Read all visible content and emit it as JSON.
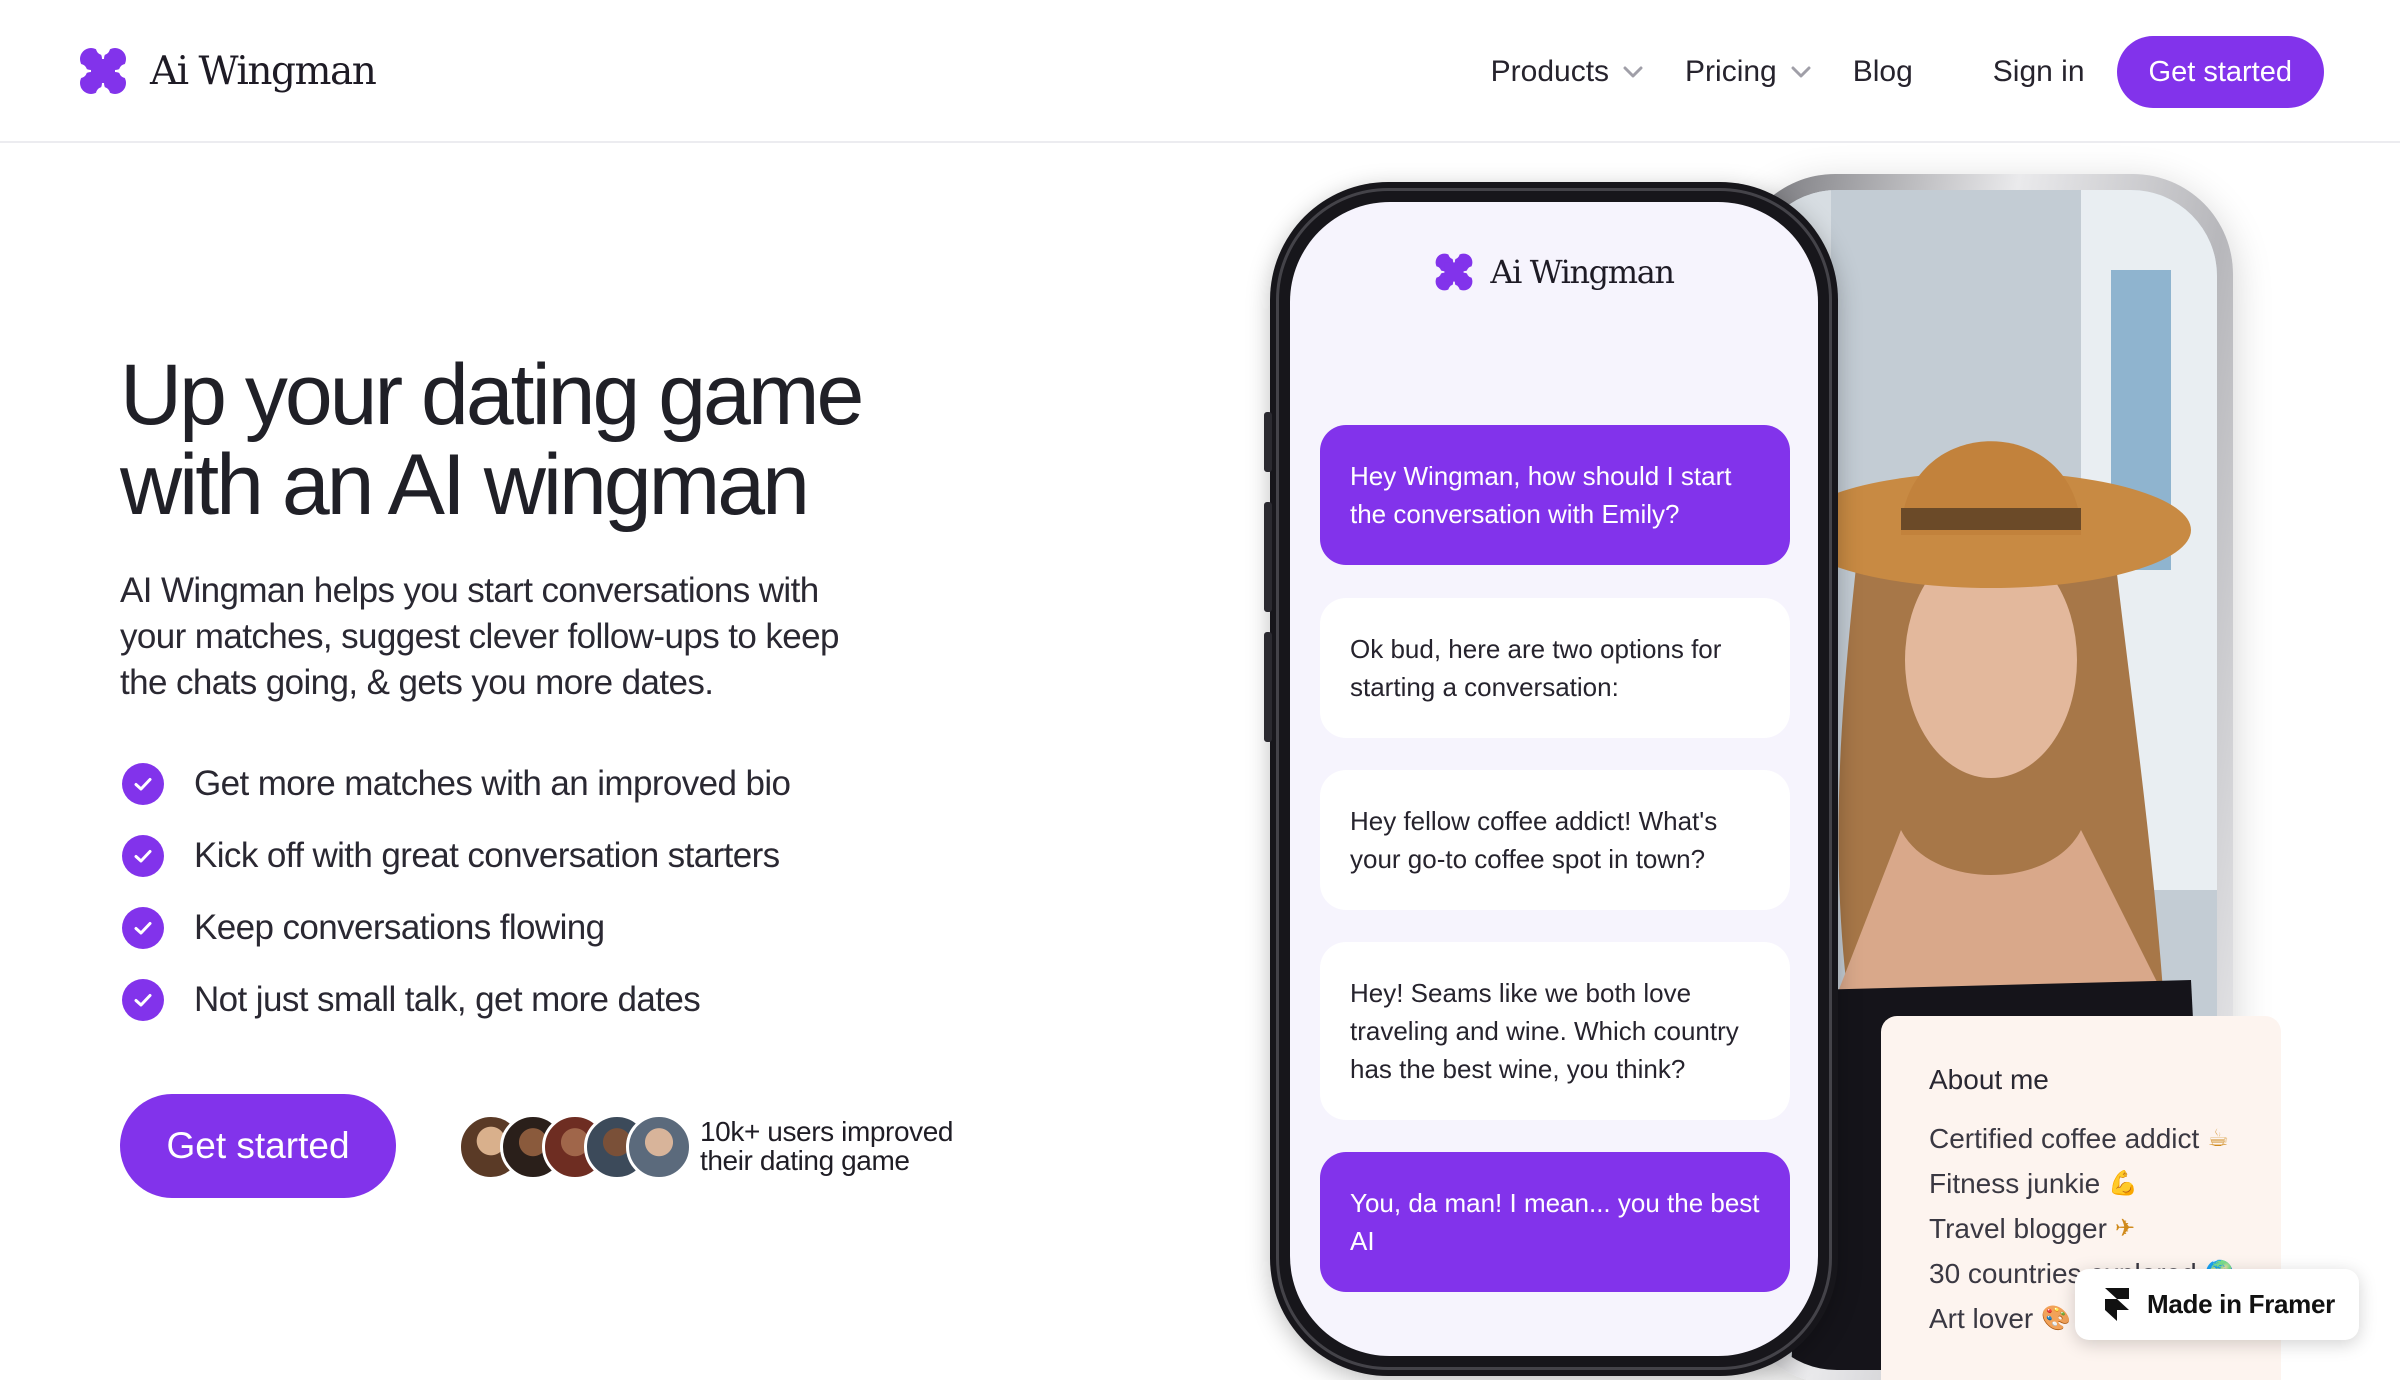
{
  "colors": {
    "accent": "#8233eb",
    "text": "#202027",
    "card_bg": "#fdf4ef",
    "screen_bg": "#f6f4fd"
  },
  "nav": {
    "brand": "Ai Wingman",
    "products": "Products",
    "pricing": "Pricing",
    "blog": "Blog",
    "sign_in": "Sign in",
    "cta": "Get started"
  },
  "hero": {
    "title_line1": "Up your dating game",
    "title_line2": "with an AI wingman",
    "subtitle": "AI Wingman helps you start conversations with your matches, suggest clever follow-ups to keep the chats going, & gets you more dates.",
    "features": [
      "Get more matches with an improved bio",
      "Kick off with great conversation starters",
      "Keep conversations flowing",
      "Not just small talk, get more dates"
    ],
    "cta": "Get started",
    "social_proof_line1": "10k+ users improved",
    "social_proof_line2": "their dating game"
  },
  "phone": {
    "brand": "Ai Wingman",
    "messages": [
      {
        "role": "user",
        "text": "Hey Wingman, how should I start the conversation with Emily?"
      },
      {
        "role": "bot",
        "text": "Ok bud, here are two options for starting a conversation:"
      },
      {
        "role": "bot",
        "text": "Hey fellow coffee addict! What's your go-to coffee spot in town?"
      },
      {
        "role": "bot",
        "text": "Hey! Seams like we both love traveling and wine. Which country has the best wine, you think?"
      },
      {
        "role": "user",
        "text": "You, da man! I mean... you the best AI"
      }
    ]
  },
  "about": {
    "title": "About me",
    "items": [
      {
        "text": "Certified coffee addict",
        "emoji": "☕"
      },
      {
        "text": "Fitness junkie",
        "emoji": "💪"
      },
      {
        "text": "Travel blogger",
        "emoji": "✈"
      },
      {
        "text": "30 countries explored",
        "emoji": "🌍"
      },
      {
        "text": "Art lover",
        "emoji": "🎨"
      }
    ]
  },
  "badge": {
    "text": "Made in Framer"
  },
  "icons": {
    "logo": "clover-logo-icon",
    "chevron": "chevron-down-icon",
    "check": "check-circle-icon",
    "framer": "framer-logo-icon"
  }
}
